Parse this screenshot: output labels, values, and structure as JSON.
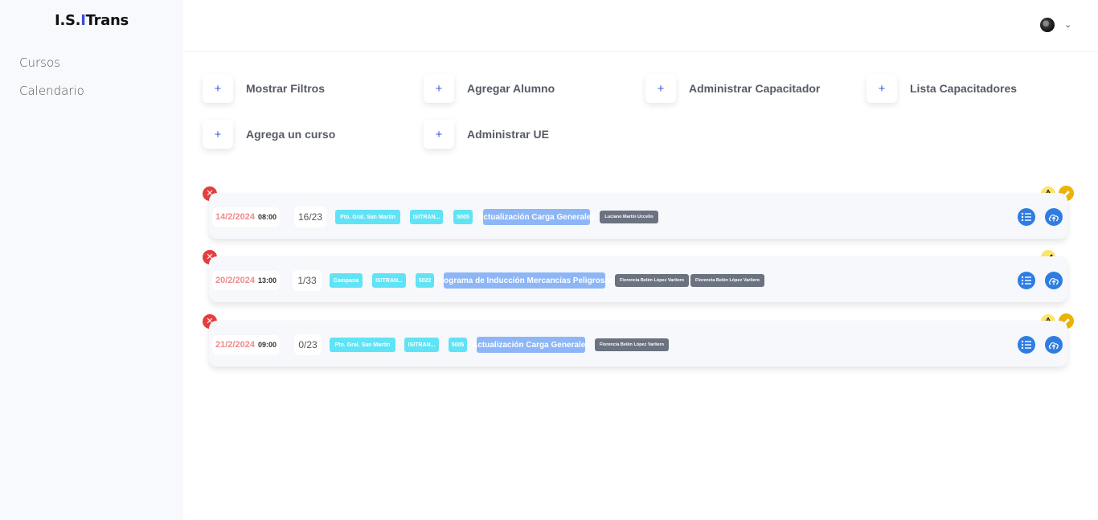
{
  "app": {
    "logo_a": "I.S.",
    "logo_b": "I",
    "logo_c": "Trans"
  },
  "sidebar": {
    "items": [
      {
        "label": "Cursos"
      },
      {
        "label": "Calendario"
      }
    ]
  },
  "actions": [
    {
      "label": "Mostrar Filtros"
    },
    {
      "label": "Agregar Alumno"
    },
    {
      "label": "Administrar Capacitador"
    },
    {
      "label": "Lista Capacitadores"
    },
    {
      "label": "Agrega un curso"
    },
    {
      "label": "Administrar UE"
    }
  ],
  "plus_symbol": "+",
  "courses": [
    {
      "date": "14/2/2024",
      "time": "08:00",
      "count": "16/23",
      "location": "Pto. Gral. San Martín",
      "org": "ISITRAN...",
      "code": "5005",
      "title": "Actualización Carga Generales",
      "instructors": [
        "Luciano Martín Uccello"
      ],
      "status": "warning"
    },
    {
      "date": "20/2/2024",
      "time": "13:00",
      "count": "1/33",
      "location": "Campana",
      "org": "ISITRAN...",
      "code": "5022",
      "title": "Programa de Inducción Mercancías Peligrosas",
      "instructors": [
        "Florencia Belén López Varliero",
        "Florencia Belén López Varliero"
      ],
      "status": "ok"
    },
    {
      "date": "21/2/2024",
      "time": "09:00",
      "count": "0/23",
      "location": "Pto. Gral. San Martín",
      "org": "ISITRAN...",
      "code": "5005",
      "title": "Actualización Carga Generales",
      "instructors": [
        "Florencia Belén López Varliero"
      ],
      "status": "warning"
    }
  ],
  "colors": {
    "accent": "#3b5bdb",
    "danger": "#e53e3e",
    "date": "#f08a8a",
    "chip": "#5fe3f5",
    "course": "#8db6f7",
    "person": "#6b7280",
    "button": "#2f7de1",
    "edit": "#eab308",
    "warn": "#fbe56a"
  }
}
